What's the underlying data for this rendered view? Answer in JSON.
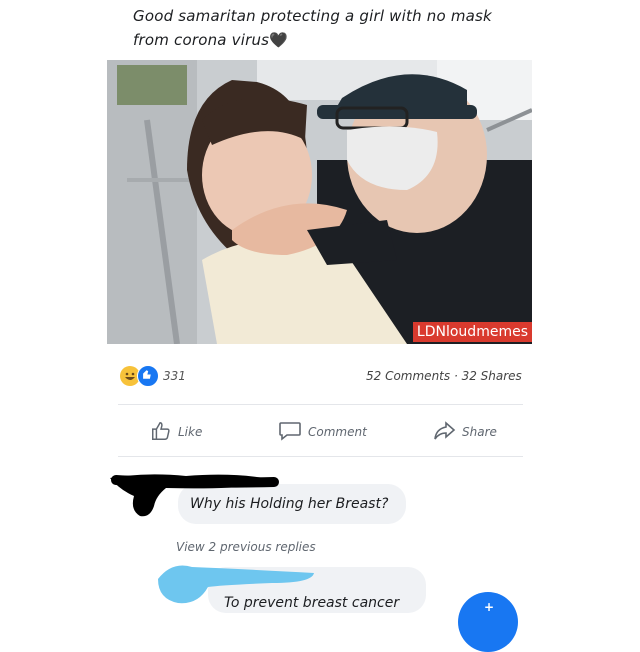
{
  "post": {
    "caption_line1": "Good samaritan protecting a girl with no mask",
    "caption_line2": "from corona virus",
    "caption_emoji": "🖤",
    "watermark": "LDNloudmemes"
  },
  "engagement": {
    "reaction_count": "331",
    "stats": "52 Comments · 32 Shares",
    "reaction_icons": [
      "haha-icon",
      "like-icon"
    ]
  },
  "actions": {
    "like": "Like",
    "comment": "Comment",
    "share": "Share"
  },
  "comments": {
    "first_text": "Why his Holding her Breast?",
    "view_replies": "View 2 previous replies",
    "reply_text": "To prevent breast cancer"
  },
  "colors": {
    "accent": "#1877f2",
    "watermark_bg": "#d93a2e",
    "bubble_bg": "#f0f2f5",
    "redact_blue": "#6ec6ef",
    "redact_black": "#000000"
  }
}
